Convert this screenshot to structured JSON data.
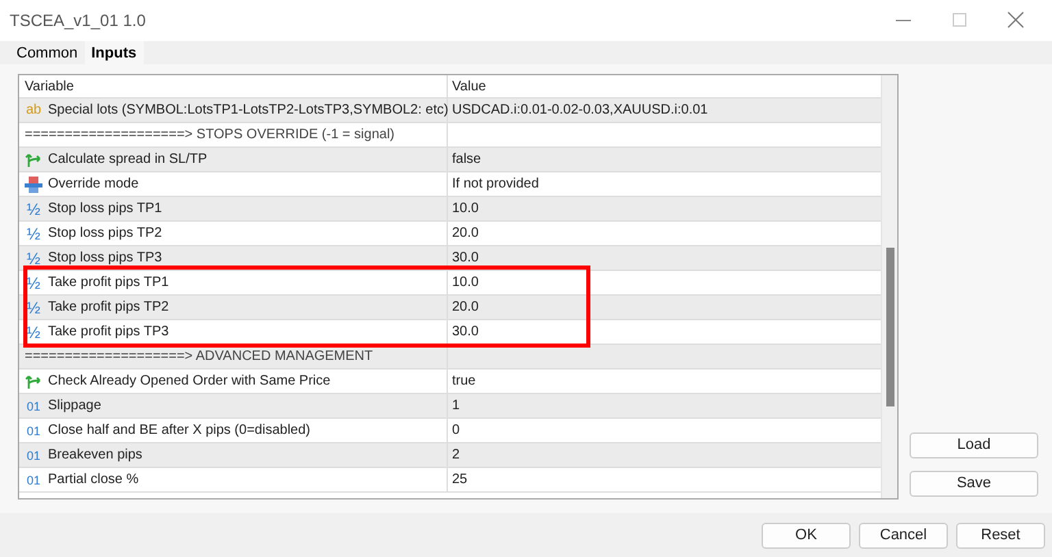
{
  "window": {
    "title": "TSCEA_v1_01 1.0"
  },
  "tabs": [
    {
      "label": "Common",
      "selected": false
    },
    {
      "label": "Inputs",
      "selected": true
    }
  ],
  "table": {
    "columns": [
      "Variable",
      "Value"
    ],
    "rows": [
      {
        "kind": "text",
        "icon": "ab",
        "variable": "Special lots (SYMBOL:LotsTP1-LotsTP2-LotsTP3,SYMBOL2: etc)",
        "value": "USDCAD.i:0.01-0.02-0.03,XAUUSD.i:0.01",
        "highlighted": false
      },
      {
        "kind": "separator",
        "variable": "====================> STOPS OVERRIDE (-1 = signal)",
        "highlighted": false
      },
      {
        "kind": "bool",
        "variable": "Calculate spread in SL/TP",
        "value": "false",
        "highlighted": false
      },
      {
        "kind": "enum",
        "variable": "Override mode",
        "value": "If not provided",
        "highlighted": false
      },
      {
        "kind": "double",
        "icon": "½",
        "variable": "Stop loss pips TP1",
        "value": "10.0",
        "highlighted": false
      },
      {
        "kind": "double",
        "icon": "½",
        "variable": "Stop loss pips TP2",
        "value": "20.0",
        "highlighted": false
      },
      {
        "kind": "double",
        "icon": "½",
        "variable": "Stop loss pips TP3",
        "value": "30.0",
        "highlighted": false
      },
      {
        "kind": "double",
        "icon": "½",
        "variable": "Take profit pips TP1",
        "value": "10.0",
        "highlighted": true
      },
      {
        "kind": "double",
        "icon": "½",
        "variable": "Take profit pips TP2",
        "value": "20.0",
        "highlighted": true
      },
      {
        "kind": "double",
        "icon": "½",
        "variable": "Take profit pips TP3",
        "value": "30.0",
        "highlighted": true
      },
      {
        "kind": "separator",
        "variable": "====================> ADVANCED MANAGEMENT",
        "highlighted": false
      },
      {
        "kind": "bool",
        "variable": "Check Already Opened Order with Same Price",
        "value": "true",
        "highlighted": false
      },
      {
        "kind": "int",
        "icon": "01",
        "variable": "Slippage",
        "value": "1",
        "highlighted": false
      },
      {
        "kind": "int",
        "icon": "01",
        "variable": "Close half and BE after X pips (0=disabled)",
        "value": "0",
        "highlighted": false
      },
      {
        "kind": "int",
        "icon": "01",
        "variable": "Breakeven pips",
        "value": "2",
        "highlighted": false
      },
      {
        "kind": "int",
        "icon": "01",
        "variable": "Partial close %",
        "value": "25",
        "highlighted": false
      }
    ]
  },
  "side_buttons": [
    "Load",
    "Save"
  ],
  "footer_buttons": [
    "OK",
    "Cancel",
    "Reset"
  ]
}
